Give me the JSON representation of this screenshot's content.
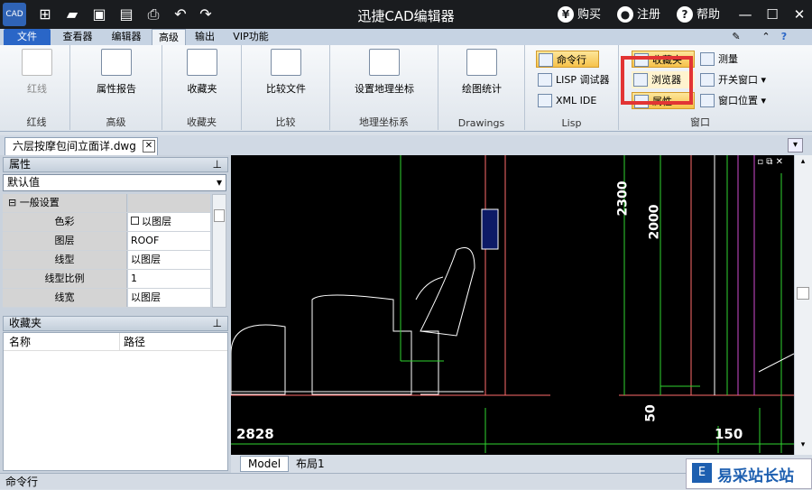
{
  "titlebar": {
    "logo_text": "CAD",
    "title": "迅捷CAD编辑器",
    "buy": "购买",
    "register": "注册",
    "help": "帮助"
  },
  "tabs": [
    "文件",
    "查看器",
    "编辑器",
    "高级",
    "输出",
    "VIP功能"
  ],
  "ribbon": {
    "groups": {
      "redline": {
        "btn": "红线",
        "label": "红线"
      },
      "advanced": {
        "btn": "属性报告",
        "label": "高级"
      },
      "favorites": {
        "btn": "收藏夹",
        "label": "收藏夹"
      },
      "compare": {
        "btn": "比较文件",
        "label": "比较"
      },
      "geo": {
        "btn": "设置地理坐标",
        "label": "地理坐标系"
      },
      "drawings": {
        "btn": "绘图统计",
        "label": "Drawings"
      },
      "lisp": {
        "cmd": "命令行",
        "debugger": "LISP 调试器",
        "xml": "XML IDE",
        "label": "Lisp"
      },
      "window": {
        "favorites": "收藏夹",
        "browser": "浏览器",
        "props": "属性",
        "measure": "测量",
        "switch": "开关窗口",
        "position": "窗口位置",
        "label": "窗口"
      }
    }
  },
  "document_tab": "六层按摩包间立面详.dwg",
  "properties": {
    "header": "属性",
    "dropdown": "默认值",
    "section": "一般设置",
    "rows": [
      {
        "k": "色彩",
        "v": "以图层"
      },
      {
        "k": "图层",
        "v": "ROOF"
      },
      {
        "k": "线型",
        "v": "以图层"
      },
      {
        "k": "线型比例",
        "v": "1"
      },
      {
        "k": "线宽",
        "v": "以图层"
      }
    ]
  },
  "favorites": {
    "header": "收藏夹",
    "col_name": "名称",
    "col_path": "路径"
  },
  "dimensions": {
    "d2300": "2300",
    "d2000": "2000",
    "d50": "50",
    "d2828": "2828",
    "d150": "150"
  },
  "layout_tabs": [
    "Model",
    "布局1"
  ],
  "status": "命令行",
  "watermark": "易采站长站"
}
